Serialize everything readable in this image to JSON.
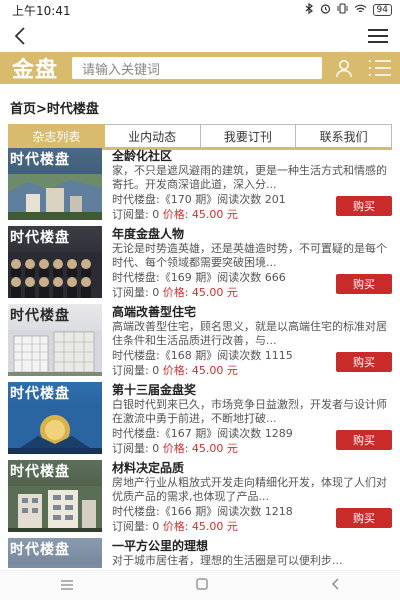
{
  "status": {
    "time": "上午10:41",
    "battery": "94"
  },
  "search": {
    "placeholder": "请输入关键词"
  },
  "brand": {
    "logo_text": "金盘",
    "accent": "#d9bb6e"
  },
  "breadcrumb": "首页>时代楼盘",
  "tabs": [
    {
      "label": "杂志列表",
      "active": true
    },
    {
      "label": "业内动态",
      "active": false
    },
    {
      "label": "我要订刊",
      "active": false
    },
    {
      "label": "联系我们",
      "active": false
    }
  ],
  "buy_label": "购买",
  "price_label": "价格:",
  "magazines": [
    {
      "cover_title": "时代楼盘",
      "title": "全龄化社区",
      "desc": "家，不只是遮风避雨的建筑，更是一种生活方式和情感的寄托。开发商深谙此道，深入分...",
      "meta": "时代楼盘:《170 期》阅读次数 201",
      "orders": "订阅量: 0 ",
      "price": "45.00 元"
    },
    {
      "cover_title": "时代楼盘",
      "title": "年度金盘人物",
      "desc": "无论是时势造英雄，还是英雄造时势，不可置疑的是每个时代、每个领域都需要突破困境...",
      "meta": "时代楼盘:《169 期》阅读次数 666",
      "orders": "订阅量: 0 ",
      "price": "45.00 元"
    },
    {
      "cover_title": "时代楼盘",
      "title": "高端改善型住宅",
      "desc": "高端改善型住宅，顾名思义，就是以高端住宅的标准对居住条件和生活品质进行改善，与...",
      "meta": "时代楼盘:《168 期》阅读次数 1115",
      "orders": "订阅量: 0 ",
      "price": "45.00 元"
    },
    {
      "cover_title": "时代楼盘",
      "title": "第十三届金盘奖",
      "desc": "白银时代到来已久，市场竞争日益激烈，开发者与设计师在激流中勇于前进，不断地打破...",
      "meta": "时代楼盘:《167 期》阅读次数 1289",
      "orders": "订阅量: 0 ",
      "price": "45.00 元"
    },
    {
      "cover_title": "时代楼盘",
      "title": "材料决定品质",
      "desc": "房地产行业从粗放式开发走向精细化开发，体现了人们对优质产品的需求,也体现了产品...",
      "meta": "时代楼盘:《166 期》阅读次数 1218",
      "orders": "订阅量: 0 ",
      "price": "45.00 元"
    },
    {
      "cover_title": "时代楼盘",
      "title": "一平方公里的理想",
      "desc": "对于城市居住者，理想的生活圈是可以便利步...",
      "meta": "",
      "orders": "",
      "price": ""
    }
  ]
}
